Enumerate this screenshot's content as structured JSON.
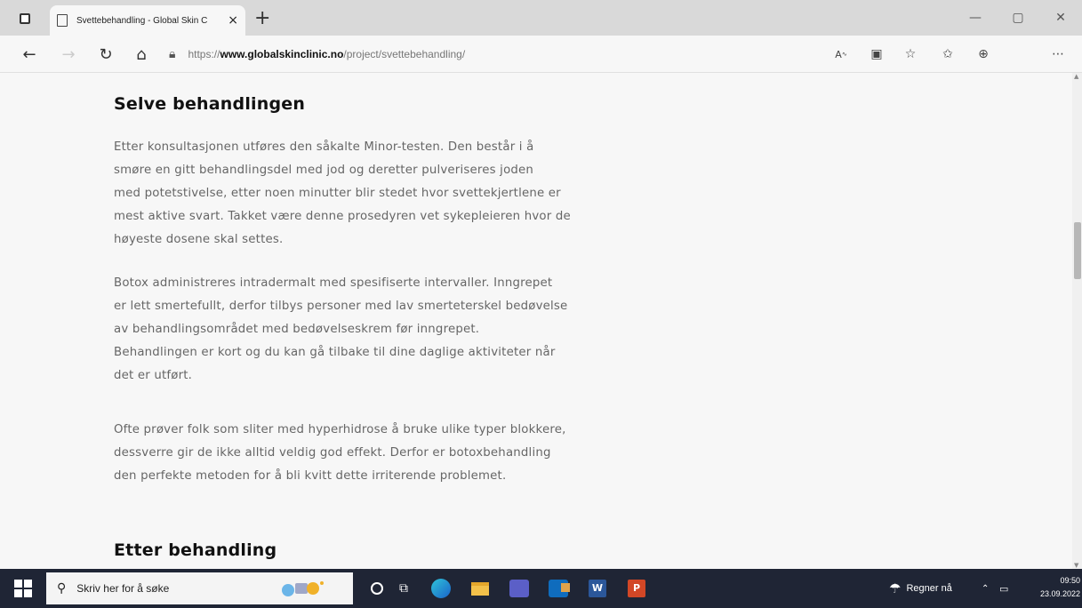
{
  "browser": {
    "tab_title": "Svettebehandling - Global Skin C",
    "tab_close": "×",
    "new_tab": "+",
    "url_prefix": "https://",
    "url_host": "www.globalskinclinic.no",
    "url_path": "/project/svettebehandling/"
  },
  "article": {
    "heading1": "Selve behandlingen",
    "para1_lines": [
      "Etter konsultasjonen utføres den såkalte Minor-testen. Den består i å",
      "smøre en gitt behandlingsdel med jod og deretter pulveriseres joden",
      "med potetstivelse, etter noen minutter blir stedet hvor svettekjertlene er",
      "mest aktive svart. Takket være denne prosedyren vet sykepleieren hvor de",
      "høyeste dosene skal settes."
    ],
    "para2_lines": [
      "Botox administreres intradermalt med spesifiserte intervaller. Inngrepet",
      "er lett smertefullt, derfor tilbys personer med lav smerteterskel bedøvelse",
      "av behandlingsområdet med bedøvelseskrem før inngrepet.",
      "Behandlingen er kort og du kan gå tilbake til dine daglige aktiviteter når",
      "det er utført."
    ],
    "para3_lines": [
      "Ofte prøver folk som sliter med hyperhidrose å bruke ulike typer blokkere,",
      "dessverre gir de ikke alltid veldig god effekt. Derfor er botoxbehandling",
      "den perfekte metoden for å bli kvitt dette irriterende problemet."
    ],
    "heading2": "Etter behandling"
  },
  "taskbar": {
    "search_placeholder": "Skriv her for å søke",
    "weather": "Regner nå",
    "time": "09:50",
    "date": "23.09.2022"
  },
  "colors": {
    "taskbar_bg": "#1f2535",
    "page_bg": "#f7f7f7",
    "heading": "#111111",
    "body_text": "#666666"
  }
}
